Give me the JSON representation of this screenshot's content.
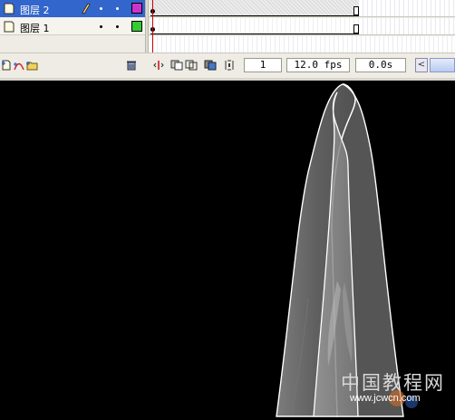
{
  "layers": [
    {
      "name": "图层 2",
      "selected": true,
      "color": "#cc33cc",
      "edit_icon": "pencil-icon"
    },
    {
      "name": "图层 1",
      "selected": false,
      "color": "#33cc33",
      "edit_icon": ""
    }
  ],
  "toolbar": {
    "buttons": [
      "insert-layer-icon",
      "add-motion-guide-icon",
      "insert-folder-icon",
      "delete-layer-icon"
    ],
    "frame_buttons": [
      "center-frame-icon",
      "onion-skin-icon",
      "onion-skin-outlines-icon",
      "edit-multiple-frames-icon",
      "modify-onion-markers-icon"
    ],
    "current_frame": "1",
    "frame_rate": "12.0 fps",
    "elapsed_time": "0.0s",
    "scroll_left": "<"
  },
  "stage": {
    "background": "#000000",
    "watermark": {
      "title": "中国教程网",
      "url": "www.jcwcn.com"
    }
  }
}
